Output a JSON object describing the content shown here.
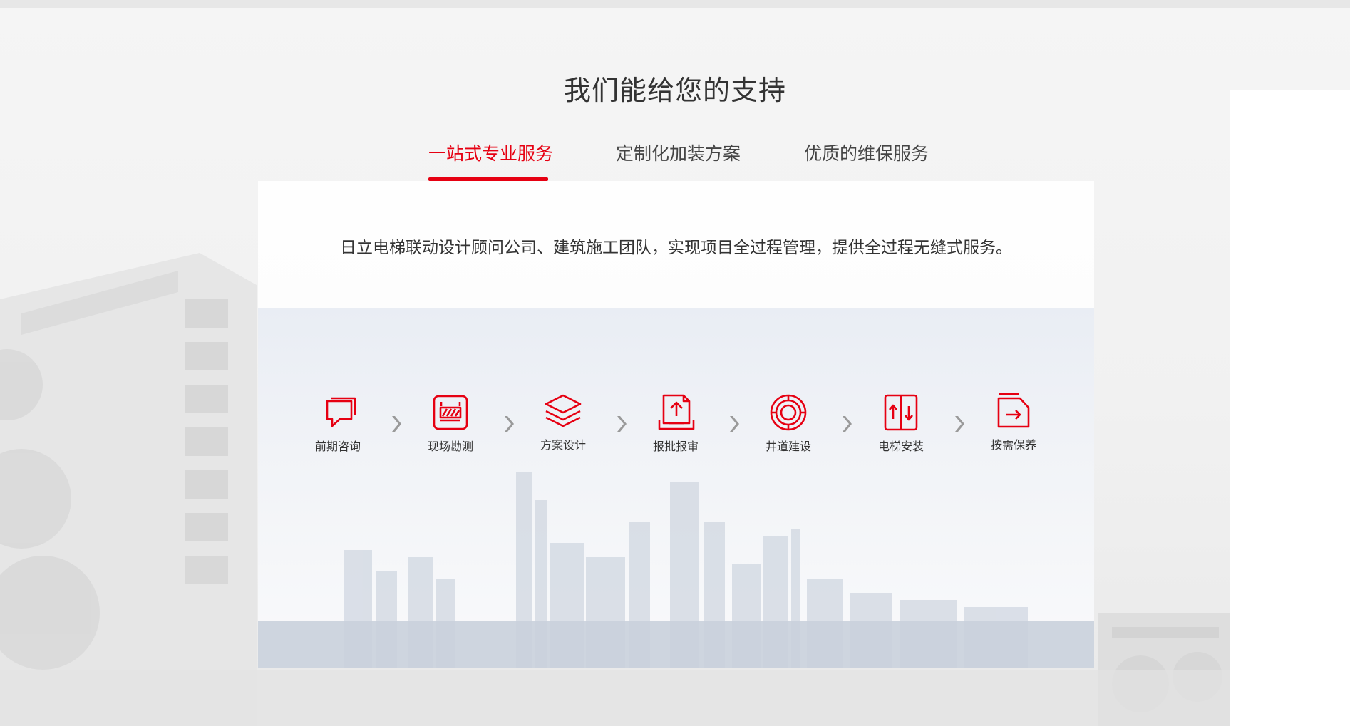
{
  "section": {
    "title": "我们能给您的支持"
  },
  "tabs": [
    {
      "label": "一站式专业服务",
      "active": true
    },
    {
      "label": "定制化加装方案",
      "active": false
    },
    {
      "label": "优质的维保服务",
      "active": false
    }
  ],
  "panel": {
    "description": "日立电梯联动设计顾问公司、建筑施工团队，实现项目全过程管理，提供全过程无缝式服务。"
  },
  "steps": [
    {
      "label": "前期咨询",
      "icon": "consult-chat-icon"
    },
    {
      "label": "现场勘测",
      "icon": "site-survey-icon"
    },
    {
      "label": "方案设计",
      "icon": "layers-design-icon"
    },
    {
      "label": "报批报审",
      "icon": "upload-approval-icon"
    },
    {
      "label": "井道建设",
      "icon": "target-shaft-icon"
    },
    {
      "label": "电梯安装",
      "icon": "elevator-doors-icon"
    },
    {
      "label": "按需保养",
      "icon": "maintenance-folder-icon"
    }
  ],
  "colors": {
    "accent": "#e60012",
    "text": "#333333",
    "arrow": "#999999"
  }
}
